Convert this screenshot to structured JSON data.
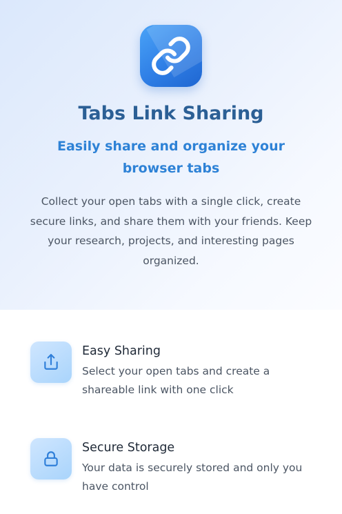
{
  "hero": {
    "logo_icon": "link-icon",
    "title": "Tabs Link Sharing",
    "subtitle": "Easily share and organize your browser tabs",
    "description": "Collect your open tabs with a single click, create secure links, and share them with your friends. Keep your research, projects, and interesting pages organized."
  },
  "features": [
    {
      "icon": "share-icon",
      "title": "Easy Sharing",
      "description": "Select your open tabs and create a shareable link with one click"
    },
    {
      "icon": "lock-icon",
      "title": "Secure Storage",
      "description": "Your data is securely stored and only you have control"
    }
  ],
  "colors": {
    "title": "#2b5f95",
    "subtitle": "#2e82d6",
    "logo": "#2f7fe6",
    "feature_icon_bg": "#bcdcfd",
    "feature_icon_stroke": "#2f7fd9"
  }
}
